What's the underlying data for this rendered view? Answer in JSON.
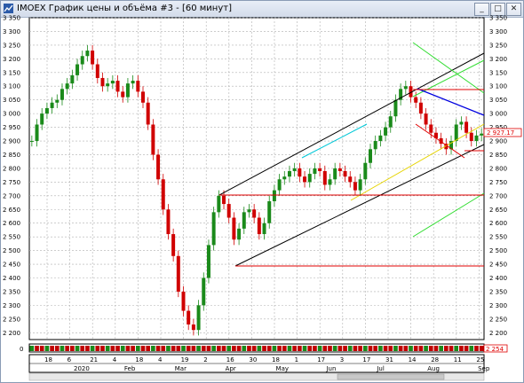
{
  "window": {
    "title": "IMOEX График цены и объёма #3 - [60 минут]",
    "minimize_glyph": "_",
    "maximize_glyph": "□",
    "close_glyph": "✕"
  },
  "chart_data": {
    "type": "candlestick",
    "title": "IMOEX График цены и объёма #3 - [60 минут]",
    "price_axis": {
      "ylim": [
        2175,
        3350
      ],
      "ticks": [
        2200,
        2250,
        2300,
        2350,
        2400,
        2450,
        2500,
        2550,
        2600,
        2650,
        2700,
        2750,
        2800,
        2850,
        2900,
        2950,
        3000,
        3050,
        3100,
        3150,
        3200,
        3250,
        3300,
        3350
      ],
      "tick_labels": [
        "2 200",
        "2 250",
        "2 300",
        "2 350",
        "2 400",
        "2 450",
        "2 500",
        "2 550",
        "2 600",
        "2 650",
        "2 700",
        "2 750",
        "2 800",
        "2 850",
        "2 900",
        "2 950",
        "3 000",
        "3 050",
        "3 100",
        "3 150",
        "3 200",
        "3 250",
        "3 300",
        "3 350"
      ],
      "last_price": 2927.17,
      "last_price_label": "2 927.17"
    },
    "volume_panel": {
      "left_label": "0",
      "right_label": "2 254"
    },
    "time_axis": {
      "day_labels": [
        "18",
        "6",
        "21",
        "4",
        "18",
        "4",
        "19",
        "2",
        "16",
        "30",
        "18",
        "1",
        "17",
        "3",
        "17",
        "31",
        "14",
        "28",
        "11",
        "25"
      ],
      "month_labels": [
        "2020",
        "Feb",
        "Mar",
        "Apr",
        "May",
        "Jun",
        "Jul",
        "Aug",
        "Sep"
      ]
    },
    "series": [
      {
        "name": "",
        "values": [
          2900,
          2960,
          3000,
          3020,
          3040,
          3050,
          3090,
          3110,
          3140,
          3180,
          3210,
          3230,
          3180,
          3130,
          3100,
          3110,
          3120,
          3080,
          3060,
          3110,
          3120,
          3080,
          3040,
          2960,
          2850,
          2760,
          2650,
          2560,
          2480,
          2350,
          2280,
          2230,
          2210,
          2300,
          2400,
          2520,
          2640,
          2700,
          2670,
          2620,
          2540,
          2580,
          2640,
          2650,
          2620,
          2560,
          2600,
          2680,
          2720,
          2760,
          2770,
          2790,
          2800,
          2770,
          2750,
          2780,
          2800,
          2790,
          2740,
          2760,
          2800,
          2790,
          2770,
          2750,
          2720,
          2760,
          2820,
          2870,
          2900,
          2920,
          2950,
          2990,
          3050,
          3090,
          3100,
          3060,
          3040,
          3000,
          2960,
          2930,
          2910,
          2890,
          2870,
          2900,
          2960,
          2970,
          2930,
          2900,
          2920,
          2927
        ]
      }
    ],
    "xlabel": "",
    "ylabel": "",
    "grid": true
  },
  "icons": {
    "app": "chart-icon"
  }
}
